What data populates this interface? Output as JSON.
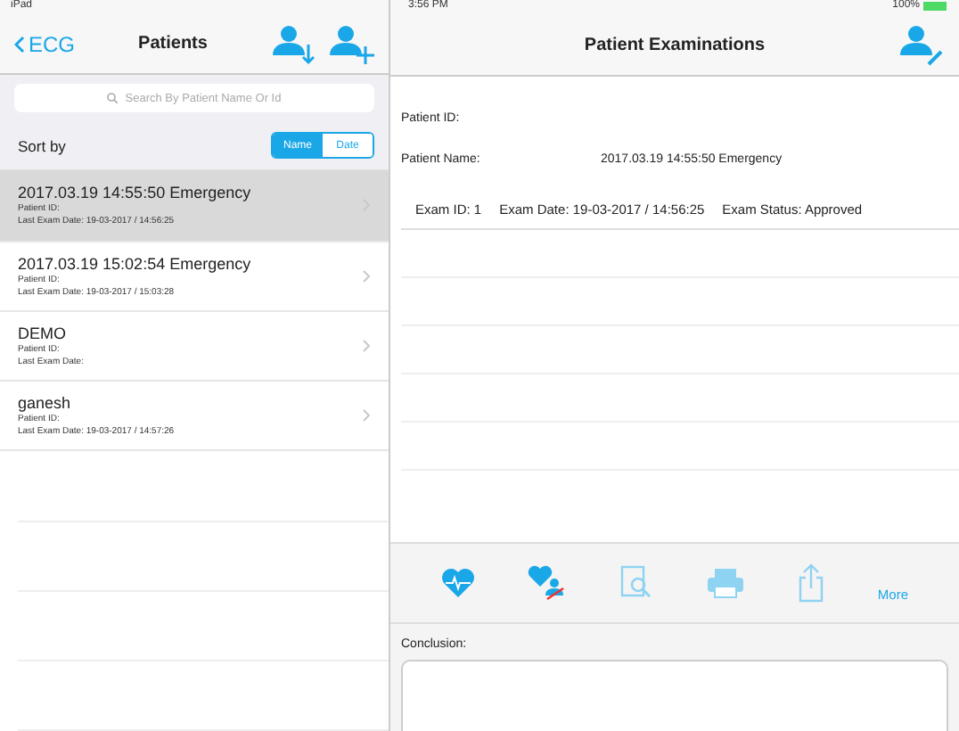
{
  "status_bar": {
    "device": "iPad",
    "time": "3:56 PM",
    "battery": "100%"
  },
  "left_nav": {
    "back": "ECG",
    "title": "Patients"
  },
  "search": {
    "placeholder": "Search By Patient Name Or Id"
  },
  "sort": {
    "label": "Sort by",
    "options": [
      {
        "label": "Name",
        "selected": true
      },
      {
        "label": "Date",
        "selected": false
      }
    ]
  },
  "patients": [
    {
      "name": "2017.03.19 14:55:50 Emergency",
      "id_label": "Patient ID:",
      "last_exam": "Last Exam Date: 19-03-2017 / 14:56:25",
      "selected": true
    },
    {
      "name": "2017.03.19 15:02:54 Emergency",
      "id_label": "Patient ID:",
      "last_exam": "Last Exam Date: 19-03-2017 / 15:03:28",
      "selected": false
    },
    {
      "name": "DEMO",
      "id_label": "Patient ID:",
      "last_exam": "Last Exam Date:",
      "selected": false
    },
    {
      "name": "ganesh",
      "id_label": "Patient ID:",
      "last_exam": "Last Exam Date: 19-03-2017 / 14:57:26",
      "selected": false
    }
  ],
  "right_nav": {
    "title": "Patient Examinations"
  },
  "details": {
    "id_label": "Patient ID:",
    "name_label": "Patient Name:",
    "name_value": "2017.03.19 14:55:50 Emergency"
  },
  "exams": [
    {
      "exam_id": "Exam ID: 1",
      "exam_date": "Exam Date: 19-03-2017 / 14:56:25",
      "exam_status": "Exam Status: Approved"
    }
  ],
  "toolbar": {
    "more": "More"
  },
  "conclusion": {
    "label": "Conclusion:"
  }
}
